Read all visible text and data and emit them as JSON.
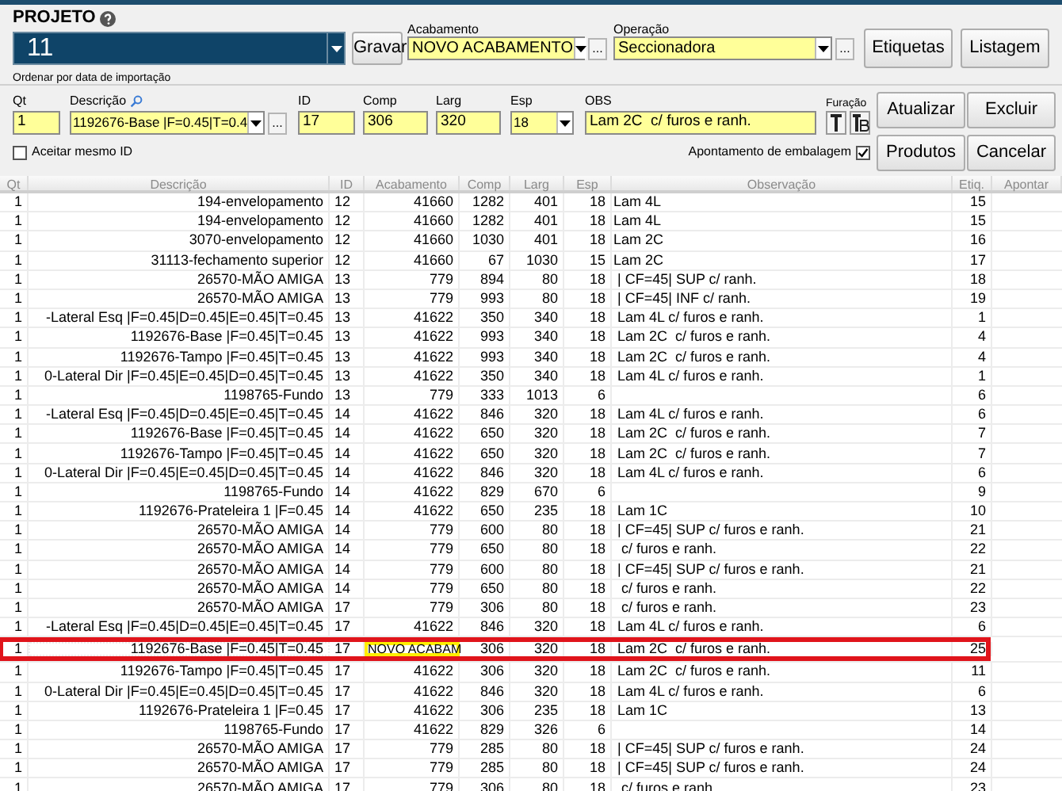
{
  "projeto": {
    "label": "PROJETO",
    "value": "11",
    "save_button": "Gravar",
    "sort_note": "Ordenar por data de importação"
  },
  "acabamento": {
    "label": "Acabamento",
    "value": "NOVO ACABAMENTO",
    "more_button": "..."
  },
  "operacao": {
    "label": "Operação",
    "value": "Seccionadora",
    "more_button": "..."
  },
  "top_buttons": [
    "Etiquetas",
    "Listagem"
  ],
  "form": {
    "fields": [
      {
        "label": "Qt",
        "value": "1",
        "kind": "text"
      },
      {
        "label": "Descrição",
        "value": "1192676-Base |F=0.45|T=0.4",
        "kind": "combo",
        "search": true,
        "more_button": "..."
      },
      {
        "label": "ID",
        "value": "17",
        "kind": "text"
      },
      {
        "label": "Comp",
        "value": "306",
        "kind": "text"
      },
      {
        "label": "Larg",
        "value": "320",
        "kind": "text"
      },
      {
        "label": "Esp",
        "value": "18",
        "kind": "combo"
      },
      {
        "label": "OBS",
        "value": "Lam 2C  c/ furos e ranh.",
        "kind": "text"
      }
    ],
    "furacao_label": "Furação",
    "accept_same_id": {
      "label": "Aceitar mesmo ID",
      "checked": false
    },
    "apontamento": {
      "label": "Apontamento de embalagem",
      "checked": true
    }
  },
  "form_buttons": [
    "Atualizar",
    "Excluir",
    "Produtos",
    "Cancelar"
  ],
  "table": {
    "columns": [
      "Qt",
      "Descrição",
      "ID",
      "Acabamento",
      "Comp",
      "Larg",
      "Esp",
      "Observação",
      "Etiq.",
      "Apontar"
    ],
    "rows": [
      {
        "selected": false,
        "qt": "1",
        "descricao": "194-envelopamento",
        "id": "12",
        "acabamento": "41660",
        "comp": "1282",
        "larg": "401",
        "esp": "18",
        "obs": "Lam 4L",
        "etiq": "15"
      },
      {
        "selected": false,
        "qt": "1",
        "descricao": "194-envelopamento",
        "id": "12",
        "acabamento": "41660",
        "comp": "1282",
        "larg": "401",
        "esp": "18",
        "obs": "Lam 4L",
        "etiq": "15"
      },
      {
        "selected": false,
        "qt": "1",
        "descricao": "3070-envelopamento",
        "id": "12",
        "acabamento": "41660",
        "comp": "1030",
        "larg": "401",
        "esp": "18",
        "obs": "Lam 2C",
        "etiq": "16"
      },
      {
        "selected": false,
        "qt": "1",
        "descricao": "31113-fechamento superior",
        "id": "12",
        "acabamento": "41660",
        "comp": "67",
        "larg": "1030",
        "esp": "15",
        "obs": "Lam 2C",
        "etiq": "17"
      },
      {
        "selected": false,
        "qt": "1",
        "descricao": "26570-MÃO AMIGA",
        "id": "13",
        "acabamento": "779",
        "comp": "894",
        "larg": "80",
        "esp": "18",
        "obs": " | CF=45| SUP c/ ranh.",
        "etiq": "18"
      },
      {
        "selected": false,
        "qt": "1",
        "descricao": "26570-MÃO AMIGA",
        "id": "13",
        "acabamento": "779",
        "comp": "993",
        "larg": "80",
        "esp": "18",
        "obs": " | CF=45| INF c/ ranh.",
        "etiq": "19"
      },
      {
        "selected": false,
        "qt": "1",
        "descricao": "-Lateral Esq |F=0.45|D=0.45|E=0.45|T=0.45",
        "id": "13",
        "acabamento": "41622",
        "comp": "350",
        "larg": "340",
        "esp": "18",
        "obs": " Lam 4L c/ furos e ranh.",
        "etiq": "1"
      },
      {
        "selected": false,
        "qt": "1",
        "descricao": "1192676-Base |F=0.45|T=0.45",
        "id": "13",
        "acabamento": "41622",
        "comp": "993",
        "larg": "340",
        "esp": "18",
        "obs": " Lam 2C  c/ furos e ranh.",
        "etiq": "4"
      },
      {
        "selected": false,
        "qt": "1",
        "descricao": "1192676-Tampo |F=0.45|T=0.45",
        "id": "13",
        "acabamento": "41622",
        "comp": "993",
        "larg": "340",
        "esp": "18",
        "obs": " Lam 2C  c/ furos e ranh.",
        "etiq": "4"
      },
      {
        "selected": false,
        "qt": "1",
        "descricao": "0-Lateral Dir |F=0.45|E=0.45|D=0.45|T=0.45",
        "id": "13",
        "acabamento": "41622",
        "comp": "350",
        "larg": "340",
        "esp": "18",
        "obs": " Lam 4L c/ furos e ranh.",
        "etiq": "1"
      },
      {
        "selected": false,
        "qt": "1",
        "descricao": "1198765-Fundo",
        "id": "13",
        "acabamento": "779",
        "comp": "333",
        "larg": "1013",
        "esp": "6",
        "etiq": "6"
      },
      {
        "selected": false,
        "qt": "1",
        "descricao": "-Lateral Esq |F=0.45|D=0.45|E=0.45|T=0.45",
        "id": "14",
        "acabamento": "41622",
        "comp": "846",
        "larg": "320",
        "esp": "18",
        "obs": " Lam 4L c/ furos e ranh.",
        "etiq": "6"
      },
      {
        "selected": false,
        "qt": "1",
        "descricao": "1192676-Base |F=0.45|T=0.45",
        "id": "14",
        "acabamento": "41622",
        "comp": "650",
        "larg": "320",
        "esp": "18",
        "obs": " Lam 2C  c/ furos e ranh.",
        "etiq": "7"
      },
      {
        "selected": false,
        "qt": "1",
        "descricao": "1192676-Tampo |F=0.45|T=0.45",
        "id": "14",
        "acabamento": "41622",
        "comp": "650",
        "larg": "320",
        "esp": "18",
        "obs": " Lam 2C  c/ furos e ranh.",
        "etiq": "7"
      },
      {
        "selected": false,
        "qt": "1",
        "descricao": "0-Lateral Dir |F=0.45|E=0.45|D=0.45|T=0.45",
        "id": "14",
        "acabamento": "41622",
        "comp": "846",
        "larg": "320",
        "esp": "18",
        "obs": " Lam 4L c/ furos e ranh.",
        "etiq": "6"
      },
      {
        "selected": false,
        "qt": "1",
        "descricao": "1198765-Fundo",
        "id": "14",
        "acabamento": "41622",
        "comp": "829",
        "larg": "670",
        "esp": "6",
        "etiq": "9"
      },
      {
        "selected": false,
        "qt": "1",
        "descricao": "1192676-Prateleira 1 |F=0.45",
        "id": "14",
        "acabamento": "41622",
        "comp": "650",
        "larg": "235",
        "esp": "18",
        "obs": " Lam 1C",
        "etiq": "10"
      },
      {
        "selected": false,
        "qt": "1",
        "descricao": "26570-MÃO AMIGA",
        "id": "14",
        "acabamento": "779",
        "comp": "600",
        "larg": "80",
        "esp": "18",
        "obs": " | CF=45| SUP c/ furos e ranh.",
        "etiq": "21"
      },
      {
        "selected": false,
        "qt": "1",
        "descricao": "26570-MÃO AMIGA",
        "id": "14",
        "acabamento": "779",
        "comp": "650",
        "larg": "80",
        "esp": "18",
        "obs": "  c/ furos e ranh.",
        "etiq": "22"
      },
      {
        "selected": false,
        "qt": "1",
        "descricao": "26570-MÃO AMIGA",
        "id": "14",
        "acabamento": "779",
        "comp": "600",
        "larg": "80",
        "esp": "18",
        "obs": " | CF=45| SUP c/ furos e ranh.",
        "etiq": "21"
      },
      {
        "selected": false,
        "qt": "1",
        "descricao": "26570-MÃO AMIGA",
        "id": "14",
        "acabamento": "779",
        "comp": "650",
        "larg": "80",
        "esp": "18",
        "obs": "  c/ furos e ranh.",
        "etiq": "22"
      },
      {
        "selected": false,
        "qt": "1",
        "descricao": "26570-MÃO AMIGA",
        "id": "17",
        "acabamento": "779",
        "comp": "306",
        "larg": "80",
        "esp": "18",
        "obs": "  c/ furos e ranh.",
        "etiq": "23"
      },
      {
        "selected": false,
        "qt": "1",
        "descricao": "-Lateral Esq |F=0.45|D=0.45|E=0.45|T=0.45",
        "id": "17",
        "acabamento": "41622",
        "comp": "846",
        "larg": "320",
        "esp": "18",
        "obs": " Lam 4L c/ furos e ranh.",
        "etiq": "6"
      },
      {
        "selected": true,
        "qt": "1",
        "descricao": "1192676-Base |F=0.45|T=0.45",
        "id": "17",
        "acabamento": "NOVO ACABAM",
        "comp": "306",
        "larg": "320",
        "esp": "18",
        "obs": " Lam 2C  c/ furos e ranh.",
        "etiq": "25"
      },
      {
        "selected": false,
        "qt": "1",
        "descricao": "1192676-Tampo |F=0.45|T=0.45",
        "id": "17",
        "acabamento": "41622",
        "comp": "306",
        "larg": "320",
        "esp": "18",
        "obs": " Lam 2C  c/ furos e ranh.",
        "etiq": "11"
      },
      {
        "selected": false,
        "qt": "1",
        "descricao": "0-Lateral Dir |F=0.45|E=0.45|D=0.45|T=0.45",
        "id": "17",
        "acabamento": "41622",
        "comp": "846",
        "larg": "320",
        "esp": "18",
        "obs": " Lam 4L c/ furos e ranh.",
        "etiq": "6"
      },
      {
        "selected": false,
        "qt": "1",
        "descricao": "1192676-Prateleira 1 |F=0.45",
        "id": "17",
        "acabamento": "41622",
        "comp": "306",
        "larg": "235",
        "esp": "18",
        "obs": " Lam 1C",
        "etiq": "13"
      },
      {
        "selected": false,
        "qt": "1",
        "descricao": "1198765-Fundo",
        "id": "17",
        "acabamento": "41622",
        "comp": "829",
        "larg": "326",
        "esp": "6",
        "etiq": "14"
      },
      {
        "selected": false,
        "qt": "1",
        "descricao": "26570-MÃO AMIGA",
        "id": "17",
        "acabamento": "779",
        "comp": "285",
        "larg": "80",
        "esp": "18",
        "obs": " | CF=45| SUP c/ furos e ranh.",
        "etiq": "24"
      },
      {
        "selected": false,
        "qt": "1",
        "descricao": "26570-MÃO AMIGA",
        "id": "17",
        "acabamento": "779",
        "comp": "285",
        "larg": "80",
        "esp": "18",
        "obs": " | CF=45| SUP c/ furos e ranh.",
        "etiq": "24"
      },
      {
        "selected": false,
        "qt": "1",
        "descricao": "26570-MÃO AMIGA",
        "id": "17",
        "acabamento": "779",
        "comp": "306",
        "larg": "80",
        "esp": "18",
        "obs": "  c/ furos e ranh.",
        "etiq": "23"
      }
    ]
  }
}
